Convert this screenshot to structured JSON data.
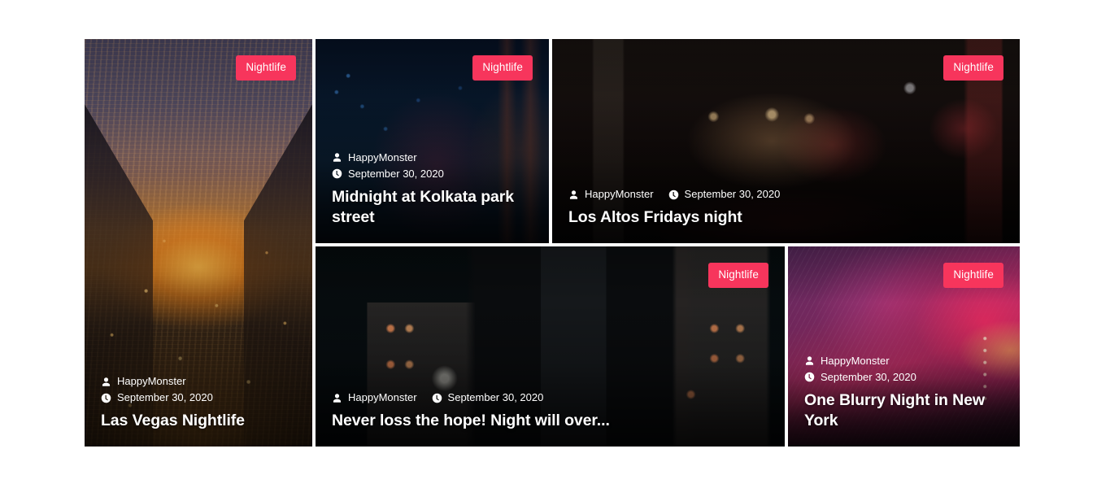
{
  "layout": {
    "kind": "blog-post-masonry-grid",
    "accent_color": "#f7355c",
    "text_color": "#ffffff",
    "page_background": "#ffffff"
  },
  "icons": {
    "author": "user-icon",
    "date": "clock-icon"
  },
  "cards": [
    {
      "id": "las-vegas-nightlife",
      "badge": "Nightlife",
      "author": "HappyMonster",
      "date": "September 30, 2020",
      "title": "Las Vegas Nightlife",
      "meta_layout": "stacked",
      "image_alt": "canal at sunset lined with golden street lights"
    },
    {
      "id": "midnight-at-kolkata-park-street",
      "badge": "Nightlife",
      "author": "HappyMonster",
      "date": "September 30, 2020",
      "title": "Midnight at Kolkata park street",
      "meta_layout": "stacked",
      "image_alt": "dark blue city street at midnight"
    },
    {
      "id": "los-altos-fridays-night",
      "badge": "Nightlife",
      "author": "HappyMonster",
      "date": "September 30, 2020",
      "title": "Los Altos Fridays night",
      "meta_layout": "inline",
      "image_alt": "crowded bar terrace at night lit by warm lamps"
    },
    {
      "id": "never-loss-the-hope",
      "badge": "Nightlife",
      "author": "HappyMonster",
      "date": "September 30, 2020",
      "title": "Never loss the hope! Night will over...",
      "meta_layout": "inline",
      "image_alt": "person in a leather jacket in front of night buildings"
    },
    {
      "id": "one-blurry-night-in-new-york",
      "badge": "Nightlife",
      "author": "HappyMonster",
      "date": "September 30, 2020",
      "title": "One Blurry Night in New York",
      "meta_layout": "stacked",
      "image_alt": "magenta and purple blurred concert lights"
    }
  ]
}
